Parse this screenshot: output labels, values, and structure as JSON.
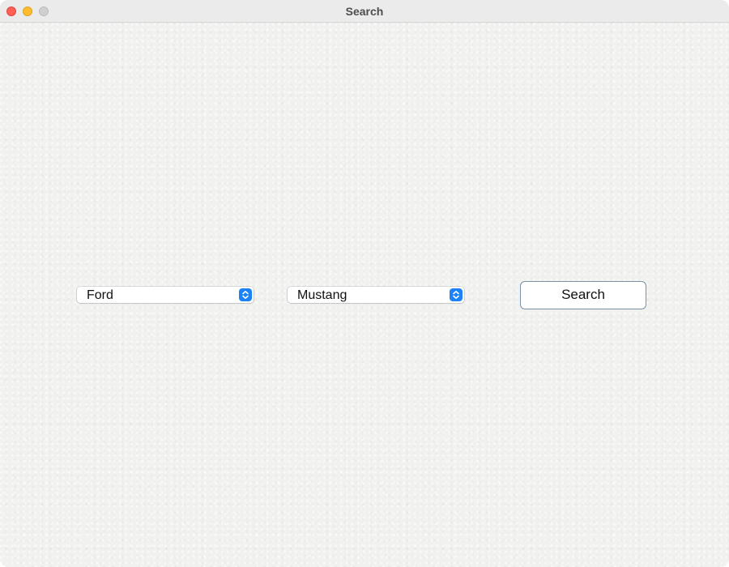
{
  "window": {
    "title": "Search"
  },
  "titlebar": {
    "buttons": [
      {
        "name": "close",
        "color": "#fe5f57"
      },
      {
        "name": "minimize",
        "color": "#febc2e"
      },
      {
        "name": "zoom",
        "color": "#cfcfcf"
      }
    ]
  },
  "form": {
    "make_select": {
      "value": "Ford",
      "icon": "chevron-up-down-icon"
    },
    "model_select": {
      "value": "Mustang",
      "icon": "chevron-up-down-icon"
    },
    "search_button": {
      "label": "Search"
    }
  },
  "colors": {
    "accent": "#1b82f7",
    "button_border": "#7a90a4",
    "background": "#f1f1ef"
  }
}
